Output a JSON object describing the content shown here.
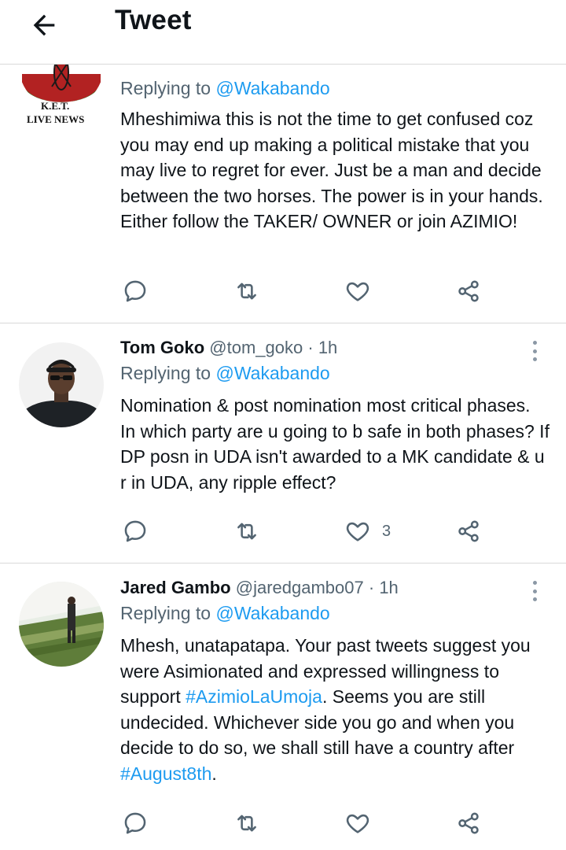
{
  "header": {
    "title": "Tweet"
  },
  "tweets": [
    {
      "replying_prefix": "Replying to ",
      "replying_to": "@Wakabando",
      "avatar_text": [
        "K.E.T.",
        "LIVE NEWS"
      ],
      "text": "Mheshimiwa this is not the time to get confused coz you may end up making a political mistake that you may live to regret for ever. Just be a man and decide between the two horses. The power is in your hands. Either follow the TAKER/ OWNER or join AZIMIO!"
    },
    {
      "name": "Tom Goko",
      "handle": "@tom_goko",
      "separator": "·",
      "time": "1h",
      "replying_prefix": "Replying to ",
      "replying_to": "@Wakabando",
      "text": "Nomination & post nomination most critical phases. In which party are u going to b safe in both phases? If DP posn in UDA isn't awarded to a MK candidate & u r in UDA, any ripple effect?",
      "like_count": "3"
    },
    {
      "name": "Jared Gambo",
      "handle": "@jaredgambo07",
      "separator": "·",
      "time": "1h",
      "replying_prefix": "Replying to ",
      "replying_to": "@Wakabando",
      "text_before_tag1": "Mhesh, unatapatapa. Your past tweets suggest you were Asimionated and expressed willingness to support ",
      "tag1": "#AzimioLaUmoja",
      "text_between": ". Seems you are still undecided. Whichever side you go and when you decide to do so, we shall still have a country after ",
      "tag2": "#August8th",
      "text_after": "."
    }
  ],
  "icons": {
    "back": "arrow-left-icon",
    "reply": "comment-icon",
    "retweet": "retweet-icon",
    "like": "heart-icon",
    "share": "share-icon",
    "more": "more-vertical-icon"
  },
  "colors": {
    "link": "#1d9bf0",
    "secondary_text": "#536471",
    "primary_text": "#0f1419",
    "divider": "#d9d9d9"
  }
}
